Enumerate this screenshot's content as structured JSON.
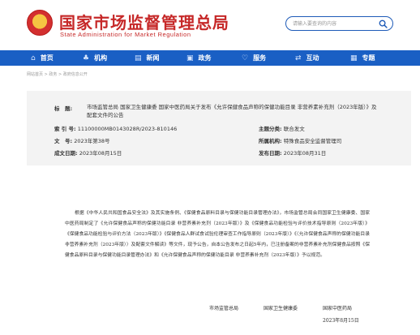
{
  "header": {
    "title": "国家市场监督管理总局",
    "subtitle": "State Administration for Market Regulation",
    "search_placeholder": "请输入要查询的内容"
  },
  "nav": {
    "items": [
      {
        "icon": "home-icon",
        "glyph": "⌂",
        "label": "首页"
      },
      {
        "icon": "org-icon",
        "glyph": "♣",
        "label": "机构"
      },
      {
        "icon": "news-icon",
        "glyph": "▤",
        "label": "新闻"
      },
      {
        "icon": "affairs-icon",
        "glyph": "▣",
        "label": "政务"
      },
      {
        "icon": "service-icon",
        "glyph": "♡",
        "label": "服务"
      },
      {
        "icon": "interact-icon",
        "glyph": "⇄",
        "label": "互动"
      },
      {
        "icon": "topic-icon",
        "glyph": "▦",
        "label": "专题"
      }
    ]
  },
  "breadcrumb": [
    "网站首页",
    "政务",
    "政府信息公开"
  ],
  "meta": {
    "title_label": "标　题:",
    "title_value": "市场监管总局 国家卫生健康委 国家中医药局关于发布《允许保健食品声称的保健功能目录 非营养素补充剂（2023年版）》及配套文件的公告",
    "index_label": "索 引 号:",
    "index_value": "11100000MB0143028R/2023-810146",
    "category_label": "主题分类:",
    "category_value": "联合发文",
    "docno_label": "文　号:",
    "docno_value": "2023年第38号",
    "dept_label": "所属机构:",
    "dept_value": "特殊食品安全监督管理司",
    "made_label": "成文日期:",
    "made_value": "2023年08月15日",
    "published_label": "发布日期:",
    "published_value": "2023年08月31日"
  },
  "body": {
    "paragraph": "根据《中华人民共和国食品安全法》及其实施条例、《保健食品原料目录与保健功能目录管理办法》，市场监管总局会同国家卫生健康委、国家中医药局制定了《允许保健食品声称的保健功能目录 非营养素补充剂（2023年版）》及《保健食品功能检验与评价技术指导原则（2023年版）》《保健食品功能检验与评价方法（2023年版）》《保健食品人群试食试验伦理审查工作指导原则（2023年版）》《〈允许保健食品声称的保健功能目录 非营养素补充剂（2023年版）〉及配套文件解读》等文件，现予公告，自本公告发布之日起5年内，已注册备案的非营养素补充剂保健食品按照《保健食品原料目录与保健功能目录管理办法》和《允许保健食品声称的保健功能目录 非营养素补充剂（2023年版）》予以规范。",
    "signers": [
      "市场监管总局",
      "国家卫生健康委",
      "国家中医药局"
    ],
    "date": "2023年8月15日"
  }
}
